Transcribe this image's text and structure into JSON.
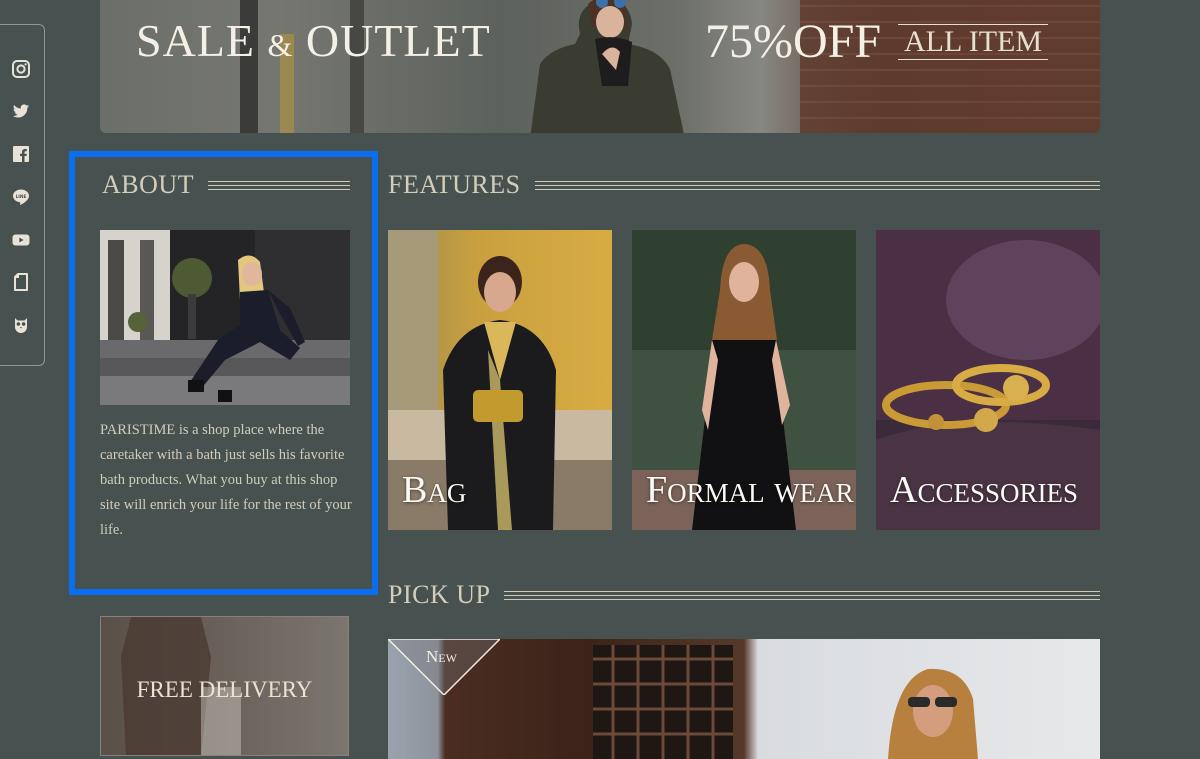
{
  "social": {
    "icons": [
      "instagram-icon",
      "twitter-icon",
      "facebook-icon",
      "line-icon",
      "youtube-icon",
      "blog-icon",
      "owl-icon"
    ]
  },
  "hero": {
    "sale_text": "SALE",
    "amp": "&",
    "outlet_text": "OUTLET",
    "discount_text": "75%OFF",
    "all_item_text": "ALL ITEM"
  },
  "about": {
    "heading": "ABOUT",
    "text": "PARISTIME is a shop place where the caretaker with a bath just sells his favorite bath products. What you buy at this shop site will enrich your life for the rest of your life."
  },
  "features": {
    "heading": "FEATURES",
    "cards": [
      {
        "label": "Bag"
      },
      {
        "label": "Formal wear"
      },
      {
        "label": "Accessories"
      }
    ]
  },
  "pickup": {
    "heading": "PICK UP",
    "delivery_text": "FREE DELIVERY",
    "new_badge": "New"
  },
  "colors": {
    "background": "#465150",
    "heading_text": "#d3cdb9",
    "highlight_border": "#0a6ef0"
  }
}
